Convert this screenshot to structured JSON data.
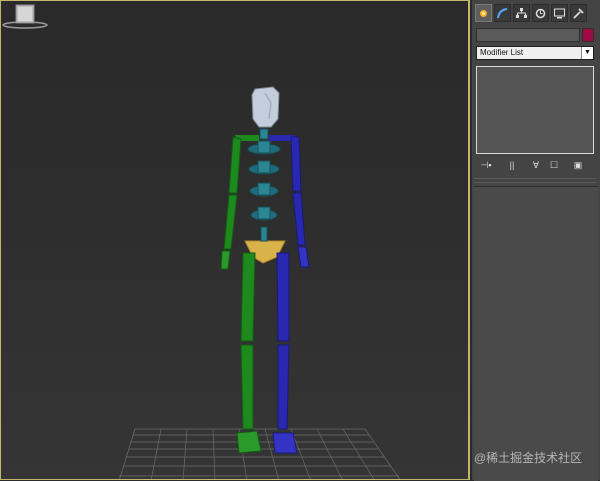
{
  "command_panel": {
    "tabs": [
      {
        "name": "create-tab-icon",
        "active": true
      },
      {
        "name": "modify-tab-icon",
        "active": false
      },
      {
        "name": "hierarchy-tab-icon",
        "active": false
      },
      {
        "name": "motion-tab-icon",
        "active": false
      },
      {
        "name": "display-tab-icon",
        "active": false
      },
      {
        "name": "utilities-tab-icon",
        "active": false
      }
    ],
    "object_name_value": "",
    "object_color": "#a00a44",
    "modifier_list_label": "Modifier List",
    "stack_toolbar_icons": [
      "pin-stack-icon",
      "show-end-result-icon",
      "make-unique-icon",
      "remove-modifier-icon",
      "configure-modifier-sets-icon"
    ]
  },
  "viewport": {
    "object": "biped-skeleton",
    "colors": {
      "left_side": "#1e8a1e",
      "right_side": "#2828b0",
      "spine": "#1f6d7a",
      "pelvis": "#d9b24a",
      "head": "#b9c4d4",
      "border": "#c8b36a"
    }
  },
  "watermark": "@稀土掘金技术社区"
}
